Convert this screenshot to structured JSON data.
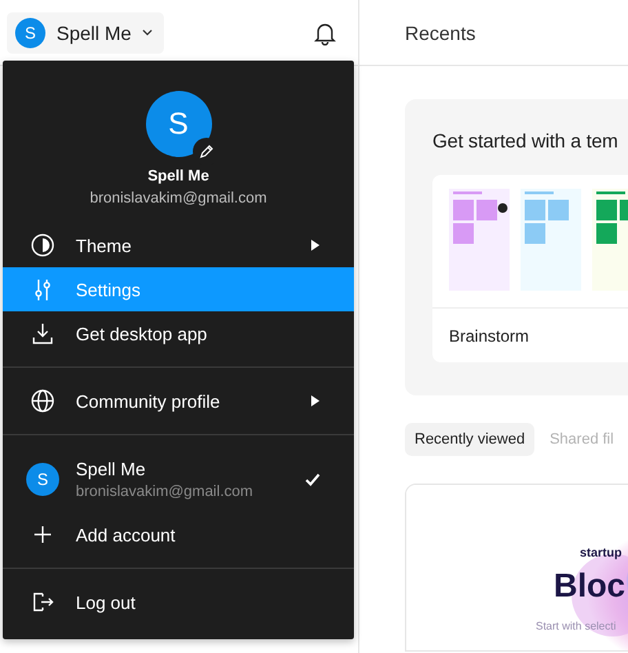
{
  "account_button": {
    "initial": "S",
    "name": "Spell Me"
  },
  "menu": {
    "profile": {
      "initial": "S",
      "name": "Spell Me",
      "email": "bronislavakim@gmail.com"
    },
    "sections": [
      [
        {
          "kind": "theme",
          "label": "Theme",
          "submenu": true,
          "selected": false
        },
        {
          "kind": "settings",
          "label": "Settings",
          "submenu": false,
          "selected": true
        },
        {
          "kind": "download",
          "label": "Get desktop app",
          "submenu": false,
          "selected": false
        }
      ],
      [
        {
          "kind": "globe",
          "label": "Community profile",
          "submenu": true,
          "selected": false
        }
      ],
      [
        {
          "kind": "account",
          "initial": "S",
          "label": "Spell Me",
          "email": "bronislavakim@gmail.com",
          "checked": true,
          "selected": false
        },
        {
          "kind": "add",
          "label": "Add account",
          "submenu": false,
          "selected": false
        }
      ],
      [
        {
          "kind": "logout",
          "label": "Log out",
          "submenu": false,
          "selected": false
        }
      ]
    ]
  },
  "page_title": "Recents",
  "templates": {
    "title": "Get started with a tem",
    "items": [
      {
        "label": "Brainstorm"
      }
    ]
  },
  "tabs": [
    {
      "label": "Recently viewed",
      "selected": true
    },
    {
      "label": "Shared fil",
      "selected": false
    }
  ],
  "files": [
    {
      "thumbnail": {
        "kicker": "startup",
        "headline": "Bloc",
        "caption": "Start with selecti"
      }
    }
  ]
}
